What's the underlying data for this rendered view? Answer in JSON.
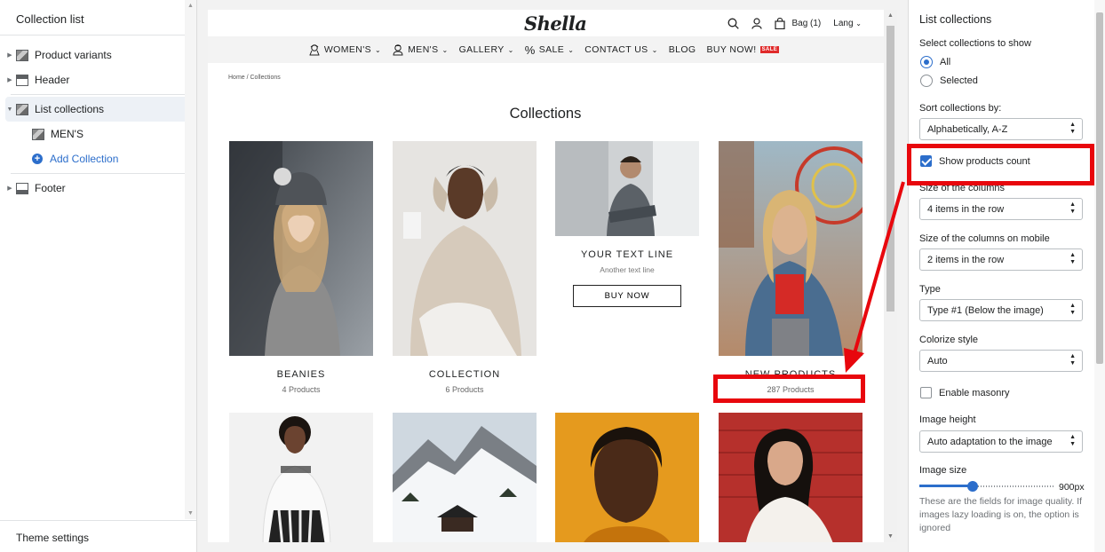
{
  "left_panel": {
    "title": "Collection list",
    "items": [
      {
        "label": "Product variants"
      },
      {
        "label": "Header"
      },
      {
        "label": "List collections"
      },
      {
        "label": "MEN'S"
      },
      {
        "label": "Add Collection"
      },
      {
        "label": "Footer"
      }
    ],
    "theme_settings": "Theme settings"
  },
  "store": {
    "logo": "Shella",
    "bag": "Bag (1)",
    "lang": "Lang",
    "nav": [
      {
        "label": "WOMEN'S"
      },
      {
        "label": "MEN'S"
      },
      {
        "label": "GALLERY"
      },
      {
        "label": "SALE"
      },
      {
        "label": "CONTACT US"
      },
      {
        "label": "BLOG"
      },
      {
        "label": "BUY NOW!"
      }
    ],
    "sale_badge": "SALE",
    "breadcrumb": "Home  /  Collections",
    "page_title": "Collections",
    "collections": [
      {
        "title": "BEANIES",
        "count": "4 Products"
      },
      {
        "title": "COLLECTION",
        "count": "6 Products"
      },
      {
        "title": "YOUR TEXT LINE",
        "subtitle": "Another text line",
        "button": "BUY NOW"
      },
      {
        "title": "NEW PRODUCTS",
        "count": "287 Products"
      }
    ]
  },
  "settings": {
    "title": "List collections",
    "select_label": "Select collections to show",
    "radio_all": "All",
    "radio_selected": "Selected",
    "radio_value": "All",
    "sort_label": "Sort collections by:",
    "sort_value": "Alphabetically, A-Z",
    "show_count_label": "Show products count",
    "show_count_checked": true,
    "columns_label": "Size of the columns",
    "columns_value": "4 items in the row",
    "columns_mobile_label": "Size of the columns on mobile",
    "columns_mobile_value": "2 items in the row",
    "type_label": "Type",
    "type_value": "Type #1 (Below the image)",
    "colorize_label": "Colorize style",
    "colorize_value": "Auto",
    "masonry_label": "Enable masonry",
    "masonry_checked": false,
    "image_height_label": "Image height",
    "image_height_value": "Auto adaptation to the image",
    "image_size_label": "Image size",
    "image_size_value": "900px",
    "image_size_fraction": 0.4,
    "help_text": "These are the fields for image quality. If images lazy loading is on, the option is ignored"
  },
  "colors": {
    "accent": "#2c6ecb",
    "highlight": "#e8070d",
    "sale": "#e02a2a"
  }
}
